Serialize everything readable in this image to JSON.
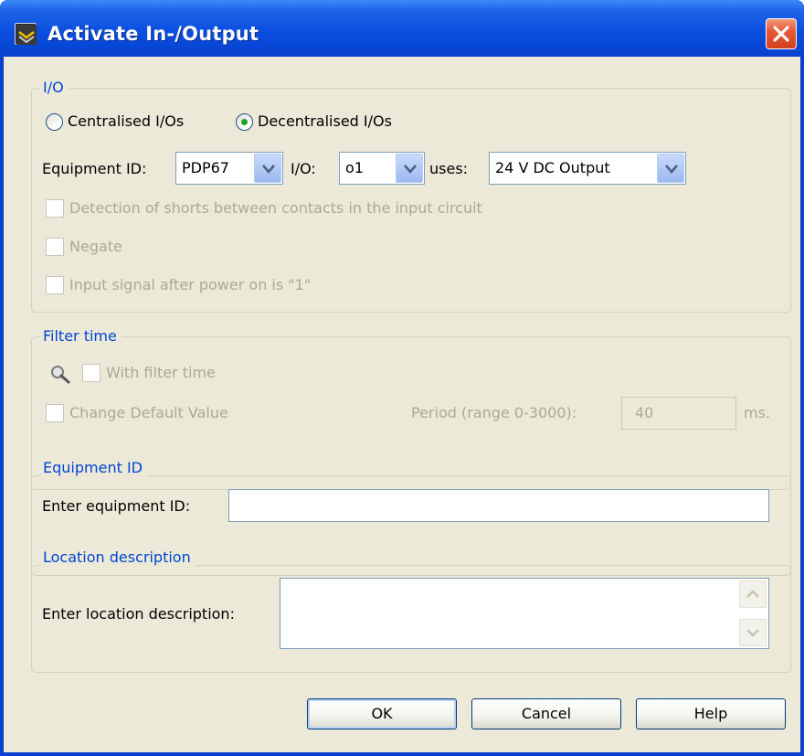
{
  "window": {
    "title": "Activate In-/Output",
    "app_icon": "app-icon",
    "close_icon": "close-icon"
  },
  "io_group": {
    "legend": "I/O",
    "radio_centralised": {
      "label": "Centralised I/Os",
      "selected": false
    },
    "radio_decentralised": {
      "label": "Decentralised I/Os",
      "selected": true
    },
    "equipment_id_label": "Equipment ID:",
    "equipment_id_value": "PDP67",
    "io_label": "I/O:",
    "io_value": "o1",
    "uses_label": "uses:",
    "uses_value": "24 V DC Output",
    "check_detection": {
      "label": "Detection of shorts between contacts in the input circuit",
      "checked": false,
      "enabled": false
    },
    "check_negate": {
      "label": "Negate",
      "checked": false,
      "enabled": false
    },
    "check_power_on": {
      "label": "Input signal after power on is \"1\"",
      "checked": false,
      "enabled": false
    }
  },
  "filter_group": {
    "legend": "Filter time",
    "icon": "magnifier-icon",
    "check_with_filter": {
      "label": "With filter time",
      "checked": false,
      "enabled": false
    },
    "check_change_default": {
      "label": "Change Default Value",
      "checked": false,
      "enabled": false
    },
    "period_label": "Period (range 0-3000):",
    "period_value": "40",
    "period_unit": "ms."
  },
  "equipment_group": {
    "legend": "Equipment ID",
    "label": "Enter equipment ID:",
    "value": ""
  },
  "location_group": {
    "legend": "Location description",
    "label": "Enter location description:",
    "value": ""
  },
  "buttons": {
    "ok": "OK",
    "cancel": "Cancel",
    "help": "Help"
  },
  "colors": {
    "title_bar": "#0a3fcf",
    "client_bg": "#ece9d8",
    "legend_text": "#0046d5",
    "disabled_text": "#aca899",
    "radio_dot": "#21a121",
    "close_button": "#d2401d"
  }
}
